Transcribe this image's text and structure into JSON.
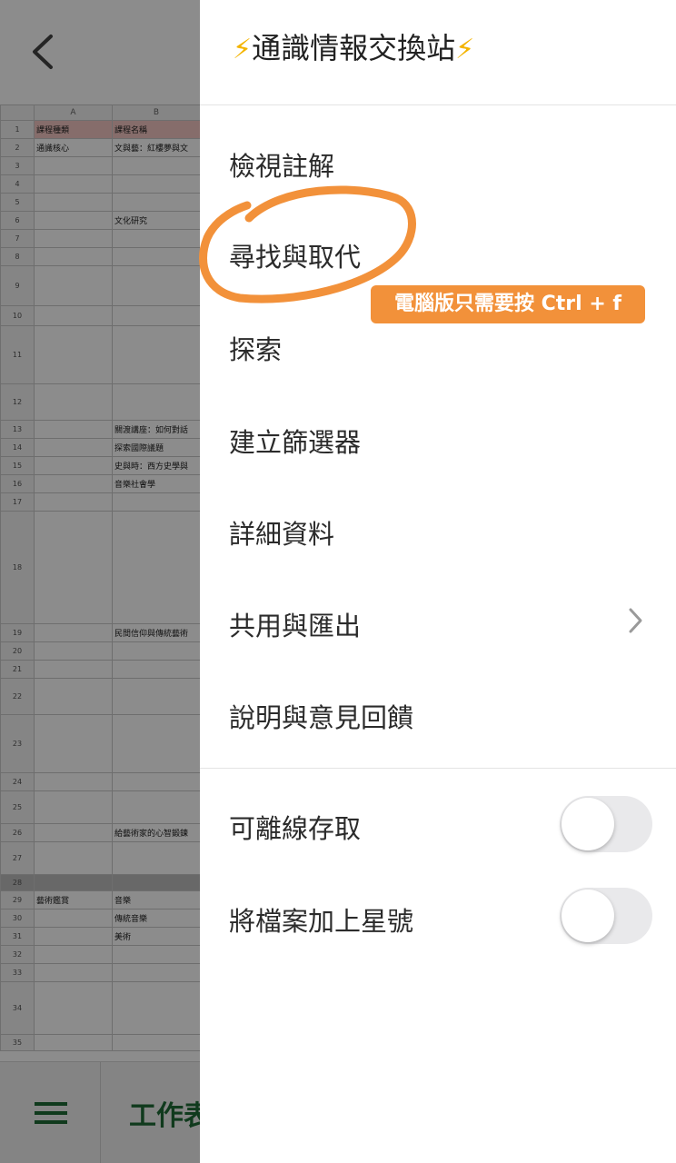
{
  "sheet": {
    "columns": [
      "A",
      "B"
    ],
    "rows": [
      {
        "n": "1",
        "a": "課程種類",
        "b": "課程名稱",
        "hl": true
      },
      {
        "n": "2",
        "a": "通識核心",
        "b": "文與藝：紅樓夢與文"
      },
      {
        "n": "3",
        "a": "",
        "b": ""
      },
      {
        "n": "4",
        "a": "",
        "b": ""
      },
      {
        "n": "5",
        "a": "",
        "b": ""
      },
      {
        "n": "6",
        "a": "",
        "b": "文化研究"
      },
      {
        "n": "7",
        "a": "",
        "b": ""
      },
      {
        "n": "8",
        "a": "",
        "b": ""
      },
      {
        "n": "9",
        "a": "",
        "b": ""
      },
      {
        "n": "10",
        "a": "",
        "b": ""
      },
      {
        "n": "11",
        "a": "",
        "b": ""
      },
      {
        "n": "12",
        "a": "",
        "b": ""
      },
      {
        "n": "13",
        "a": "",
        "b": "關渡講座：如何對話"
      },
      {
        "n": "14",
        "a": "",
        "b": "探索國際議題"
      },
      {
        "n": "15",
        "a": "",
        "b": "史與時：西方史學與"
      },
      {
        "n": "16",
        "a": "",
        "b": "音樂社會學"
      },
      {
        "n": "17",
        "a": "",
        "b": ""
      },
      {
        "n": "18",
        "a": "",
        "b": ""
      },
      {
        "n": "19",
        "a": "",
        "b": "民間信仰與傳統藝術"
      },
      {
        "n": "20",
        "a": "",
        "b": ""
      },
      {
        "n": "21",
        "a": "",
        "b": ""
      },
      {
        "n": "22",
        "a": "",
        "b": ""
      },
      {
        "n": "23",
        "a": "",
        "b": ""
      },
      {
        "n": "24",
        "a": "",
        "b": ""
      },
      {
        "n": "25",
        "a": "",
        "b": ""
      },
      {
        "n": "26",
        "a": "",
        "b": "給藝術家的心智鍛鍊"
      },
      {
        "n": "27",
        "a": "",
        "b": ""
      },
      {
        "n": "28",
        "a": "",
        "b": "",
        "gray": true
      },
      {
        "n": "29",
        "a": "藝術鑑賞",
        "b": "音樂"
      },
      {
        "n": "30",
        "a": "",
        "b": "傳統音樂"
      },
      {
        "n": "31",
        "a": "",
        "b": "美術"
      },
      {
        "n": "32",
        "a": "",
        "b": ""
      },
      {
        "n": "33",
        "a": "",
        "b": ""
      },
      {
        "n": "34",
        "a": "",
        "b": ""
      },
      {
        "n": "35",
        "a": "",
        "b": ""
      }
    ],
    "bottom_tab": "工作表"
  },
  "drawer": {
    "title": "通識情報交換站",
    "bolt": "⚡",
    "items": [
      {
        "label": "檢視註解"
      },
      {
        "label": "尋找與取代"
      },
      {
        "label": "探索"
      },
      {
        "label": "建立篩選器"
      },
      {
        "label": "詳細資料"
      },
      {
        "label": "共用與匯出"
      },
      {
        "label": "說明與意見回饋"
      }
    ],
    "toggles": [
      {
        "label": "可離線存取",
        "on": false
      },
      {
        "label": "將檔案加上星號",
        "on": false
      }
    ]
  },
  "annotation": {
    "tip": "電腦版只需要按 Ctrl + f",
    "color": "#f2913a"
  },
  "colors": {
    "accent_green": "#1e6b35",
    "toggle_off": "#e9e9eb"
  }
}
